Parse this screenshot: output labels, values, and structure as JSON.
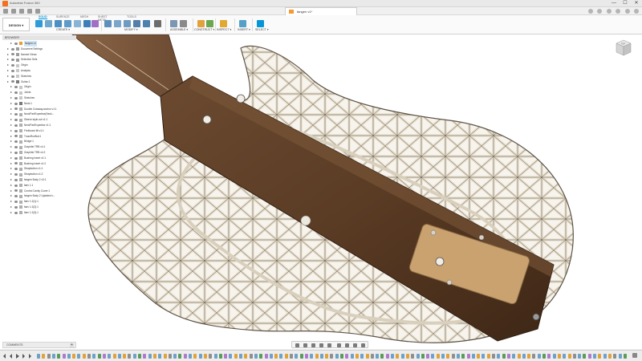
{
  "window": {
    "app_title": "Autodesk Fusion 360",
    "doc_tab": "fangen v1*",
    "controls": [
      "—",
      "☐",
      "✕"
    ]
  },
  "ribbon": {
    "workspace": "DESIGN ▾",
    "tabs": [
      "SOLID",
      "SURFACE",
      "MESH",
      "SHEET METAL",
      "TOOLS"
    ],
    "active_tab": "SOLID",
    "groups": [
      "CREATE ▾",
      "MODIFY ▾",
      "ASSEMBLE ▾",
      "CONSTRUCT ▾",
      "INSPECT ▾",
      "INSERT ▾",
      "SELECT ▾"
    ],
    "accent_color": "#0696d7"
  },
  "browser": {
    "header": "BROWSER",
    "items": [
      {
        "label": "fangen v1",
        "selected": true
      },
      {
        "label": "Document Settings"
      },
      {
        "label": "Named Views"
      },
      {
        "label": "Selection Sets"
      },
      {
        "label": "Origin"
      },
      {
        "label": "Analysis"
      },
      {
        "label": "Sketches"
      },
      {
        "label": "Guitar:1"
      },
      {
        "label": "Origin"
      },
      {
        "label": "Joints"
      },
      {
        "label": "Sketches"
      },
      {
        "label": "Neck:1"
      },
      {
        "label": "Double Cutaway.anchor v1:1"
      },
      {
        "label": "NeckPartExpertise(Neck..."
      },
      {
        "label": "Sleeve style.cut v1:1"
      },
      {
        "label": "NeckPartExpertise v1:1"
      },
      {
        "label": "Fretboard tilt v1:1"
      },
      {
        "label": "TrussRodNut:1"
      },
      {
        "label": "Bridge:1"
      },
      {
        "label": "Graphite TRB v4:1"
      },
      {
        "label": "Graphite TRB v4:2"
      },
      {
        "label": "Bushing insert v1:1"
      },
      {
        "label": "Bushing insert v1:2"
      },
      {
        "label": "Strapbutton v1:1"
      },
      {
        "label": "Strapbutton v1:2"
      },
      {
        "label": "fangen Body 2 v3:1"
      },
      {
        "label": "fairv 1:1"
      },
      {
        "label": "Control Cavity Cover:1"
      },
      {
        "label": "fangen Body 2 Updated v..."
      },
      {
        "label": "fairv 1:2(1):1"
      },
      {
        "label": "fairv 1:2(2):1"
      },
      {
        "label": "fairv 1:2(3):1"
      }
    ]
  },
  "comments": {
    "label": "COMMENTS",
    "add": "+"
  },
  "viewcube": {
    "face": "TOP"
  },
  "colors": {
    "wood": "#5a3b24",
    "lattice": "#e6ddcc",
    "lattice_edge": "#5e5446",
    "cover": "#c9a26f"
  },
  "icons": [
    "save-icon",
    "undo-icon",
    "redo-icon",
    "orbit-icon",
    "pan-icon",
    "zoom-icon",
    "fit-icon",
    "display-settings-icon",
    "grid-icon",
    "viewports-icon"
  ]
}
